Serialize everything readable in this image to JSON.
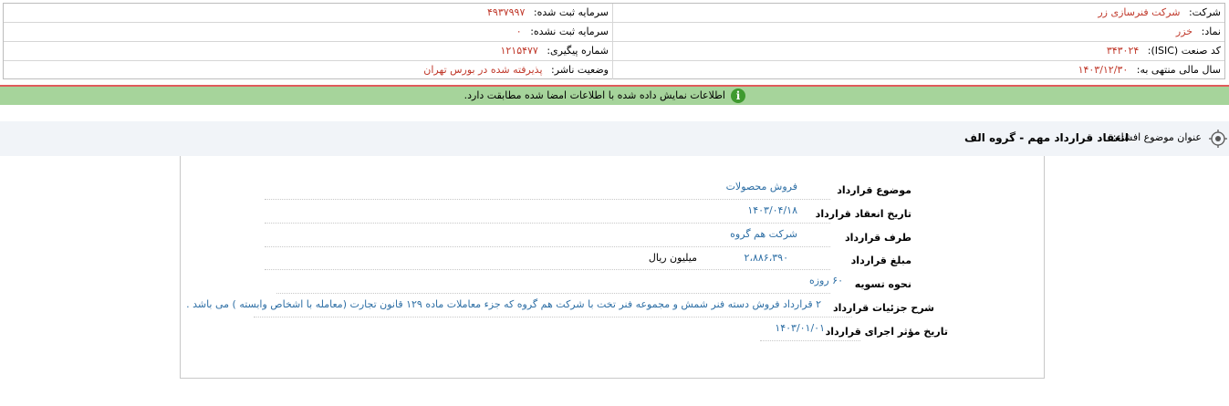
{
  "header": {
    "rows": [
      {
        "right_label": "شرکت:",
        "right_value": "شرکت فنرسازی زر",
        "left_label": "سرمایه ثبت شده:",
        "left_value": "۴۹۳۷۹۹۷"
      },
      {
        "right_label": "نماد:",
        "right_value": "خزر",
        "left_label": "سرمایه ثبت نشده:",
        "left_value": "۰"
      },
      {
        "right_label": "کد صنعت (ISIC):",
        "right_value": "۳۴۳۰۲۴",
        "left_label": "شماره پیگیری:",
        "left_value": "۱۲۱۵۴۷۷"
      },
      {
        "right_label": "سال مالی منتهی به:",
        "right_value": "۱۴۰۳/۱۲/۳۰",
        "left_label": "وضعیت ناشر:",
        "left_value": "پذیرفته شده در بورس تهران"
      }
    ]
  },
  "notice": {
    "message": "اطلاعات نمایش داده شده با اطلاعات امضا شده مطابقت دارد.",
    "icon": "info-icon",
    "color": "#a6d49b"
  },
  "topic": {
    "label": "عنوان موضوع افشاء:",
    "value": "انعقاد قرارداد مهم - گروه الف",
    "icon": "target-icon"
  },
  "contract": {
    "subject_label": "موضوع قرارداد",
    "subject_value": "فروش محصولات",
    "date_label": "تاریخ انعقاد قرارداد",
    "date_value": "۱۴۰۳/۰۴/۱۸",
    "party_label": "طرف قرارداد",
    "party_value": "شرکت هم گروه",
    "amount_label": "مبلغ قرارداد",
    "amount_value": "۲،۸۸۶،۳۹۰",
    "amount_unit": "میلیون ریال",
    "settlement_label": "نحوه تسویه",
    "settlement_value": "۶۰ روزه",
    "details_label": "شرح جزئیات قرارداد",
    "details_value": "۲ قرارداد فروش دسته فنر شمش و مجموعه فنر تخت با شرکت هم گروه که جزء معاملات ماده ۱۲۹ قانون تجارت (معامله با اشخاص وابسته ) می باشد .",
    "effective_label": "تاریخ مؤثر اجرای قرارداد",
    "effective_value": "۱۴۰۳/۰۱/۰۱"
  }
}
